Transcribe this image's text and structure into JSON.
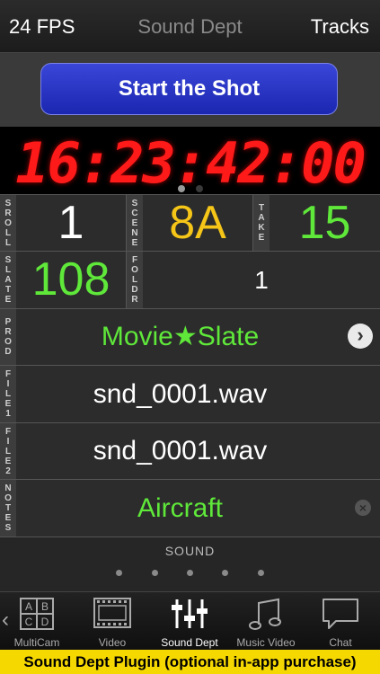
{
  "topbar": {
    "fps": "24 FPS",
    "title": "Sound Dept",
    "tracks": "Tracks"
  },
  "start_button": "Start the Shot",
  "timecode": "16:23:42:00",
  "timecode_page_dots": {
    "active": 0,
    "count": 2
  },
  "fields": {
    "roll": {
      "label": "SROLL",
      "value": "1"
    },
    "scene": {
      "label": "SCENE",
      "value": "8A"
    },
    "take": {
      "label": "TAKE",
      "value": "15"
    },
    "slate": {
      "label": "SLATE",
      "value": "108"
    },
    "folder": {
      "label": "FOLDR",
      "value": "1"
    },
    "prod": {
      "label": "PROD",
      "value": "Movie★Slate"
    },
    "file1": {
      "label": "FILE1",
      "value": "snd_0001.wav"
    },
    "file2": {
      "label": "FILE2",
      "value": "snd_0001.wav"
    },
    "notes": {
      "label": "NOTES",
      "value": "Aircraft"
    }
  },
  "sound_section": {
    "label": "SOUND",
    "page_dot_count": 5
  },
  "tabs": [
    {
      "label": "MultiCam",
      "icon": "multicam-grid-icon",
      "active": false
    },
    {
      "label": "Video",
      "icon": "film-icon",
      "active": false
    },
    {
      "label": "Sound Dept",
      "icon": "mixer-sliders-icon",
      "active": true
    },
    {
      "label": "Music Video",
      "icon": "music-note-icon",
      "active": false
    },
    {
      "label": "Chat",
      "icon": "chat-bubble-icon",
      "active": false
    }
  ],
  "banner": "Sound Dept Plugin (optional in-app purchase)",
  "colors": {
    "accent_blue": "#2433c8",
    "timecode_red": "#ff1a1a",
    "value_green": "#5fe83a",
    "value_yellow": "#f5c518",
    "banner_yellow": "#f5d800"
  }
}
